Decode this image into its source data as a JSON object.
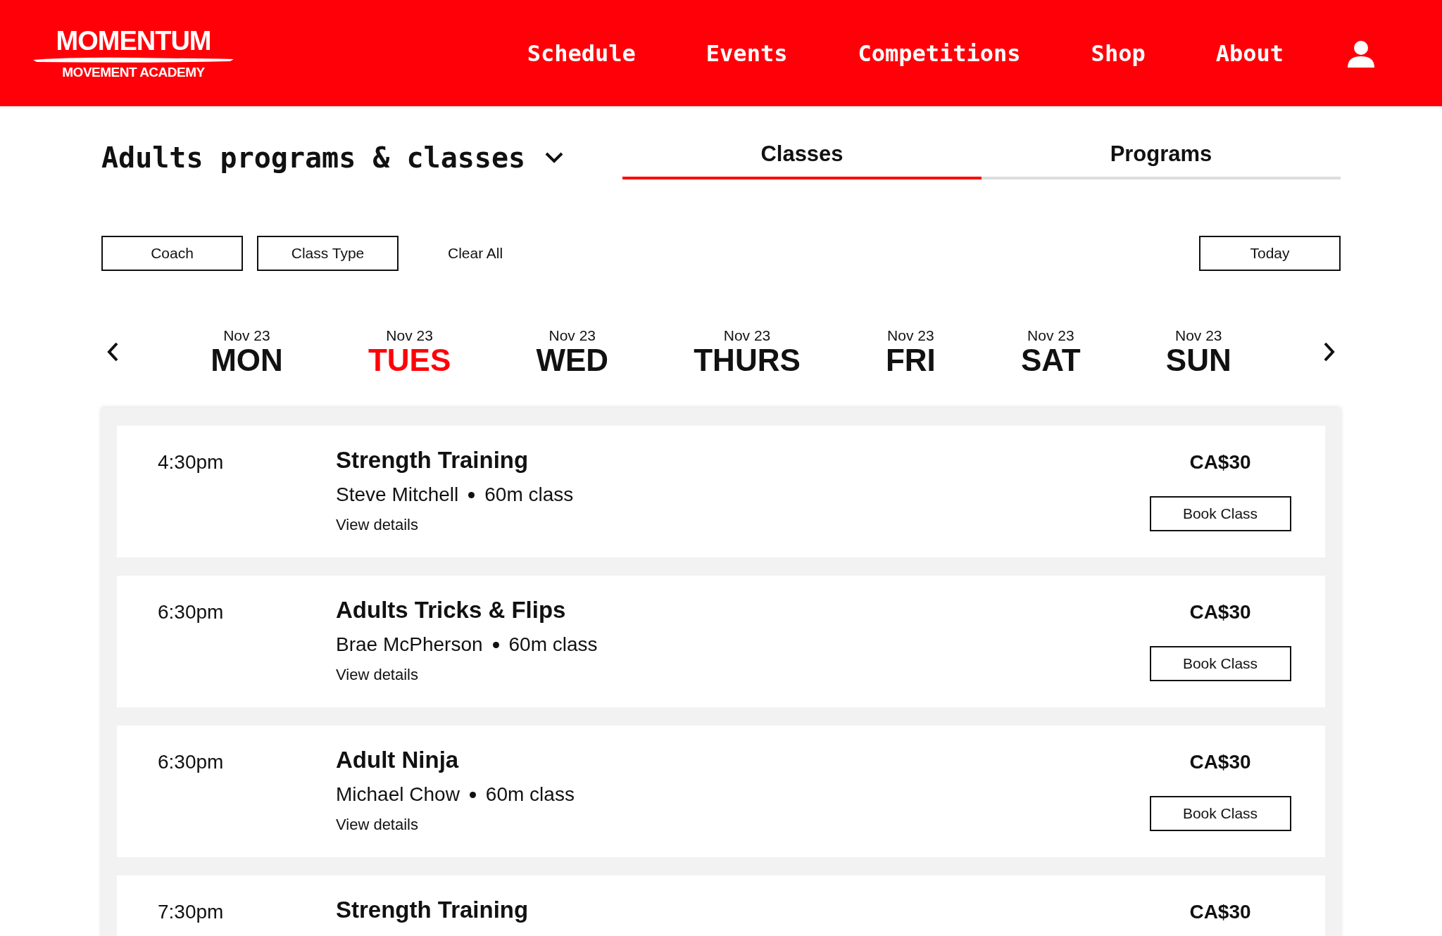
{
  "header": {
    "logo": {
      "name": "MOMENTUM",
      "tagline": "MOVEMENT ACADEMY"
    },
    "nav": [
      "Schedule",
      "Events",
      "Competitions",
      "Shop",
      "About"
    ]
  },
  "page_title": "Adults programs & classes",
  "tabs": [
    {
      "label": "Classes",
      "selected": true
    },
    {
      "label": "Programs",
      "selected": false
    }
  ],
  "filters": [
    "Coach",
    "Class Type"
  ],
  "clear_all": "Clear All",
  "today_button": "Today",
  "days": [
    {
      "date": "Nov 23",
      "day": "MON",
      "selected": false
    },
    {
      "date": "Nov 23",
      "day": "TUES",
      "selected": true
    },
    {
      "date": "Nov 23",
      "day": "WED",
      "selected": false
    },
    {
      "date": "Nov 23",
      "day": "THURS",
      "selected": false
    },
    {
      "date": "Nov 23",
      "day": "FRI",
      "selected": false
    },
    {
      "date": "Nov 23",
      "day": "SAT",
      "selected": false
    },
    {
      "date": "Nov 23",
      "day": "SUN",
      "selected": false
    }
  ],
  "classes": [
    {
      "time": "4:30pm",
      "title": "Strength Training",
      "coach": "Steve Mitchell",
      "duration": "60m class",
      "details": "View details",
      "price": "CA$30",
      "button": "Book Class"
    },
    {
      "time": "6:30pm",
      "title": "Adults Tricks & Flips",
      "coach": "Brae McPherson",
      "duration": "60m class",
      "details": "View details",
      "price": "CA$30",
      "button": "Book Class"
    },
    {
      "time": "6:30pm",
      "title": "Adult Ninja",
      "coach": "Michael Chow",
      "duration": "60m class",
      "details": "View details",
      "price": "CA$30",
      "button": "Book Class"
    },
    {
      "time": "7:30pm",
      "title": "Strength Training",
      "price": "CA$30"
    }
  ]
}
